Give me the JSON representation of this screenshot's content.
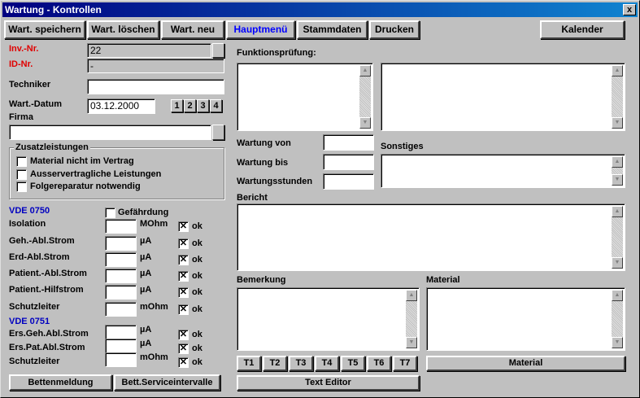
{
  "window": {
    "title": "Wartung - Kontrollen",
    "close_glyph": "x"
  },
  "toolbar": {
    "save": "Wart. speichern",
    "delete": "Wart. löschen",
    "new": "Wart. neu",
    "main_menu": "Hauptmenü",
    "master_data": "Stammdaten",
    "print": "Drucken",
    "calendar": "Kalender"
  },
  "form": {
    "inv_label": "Inv.-Nr.",
    "inv_value": "22",
    "id_label": "ID-Nr.",
    "id_value": "-",
    "tech_label": "Techniker",
    "tech_value": "",
    "date_label": "Wart.-Datum",
    "date_value": "03.12.2000",
    "date_buttons": [
      "1",
      "2",
      "3",
      "4"
    ],
    "firm_label": "Firma",
    "firm_value": ""
  },
  "extras": {
    "title": "Zusatzleistungen",
    "items": [
      "Material nicht im Vertrag",
      "Ausservertragliche Leistungen",
      "Folgereparatur notwendig"
    ],
    "checked": [
      false,
      false,
      false
    ]
  },
  "vde0750": {
    "title": "VDE 0750",
    "hazard_label": "Gefährdung",
    "hazard_checked": false,
    "rows": [
      {
        "label": "Isolation",
        "value": "",
        "unit": "MOhm",
        "ok": "ok",
        "ok_checked": true
      },
      {
        "label": "Geh.-Abl.Strom",
        "value": "",
        "unit": "µA",
        "ok": "ok",
        "ok_checked": true
      },
      {
        "label": "Erd-Abl.Strom",
        "value": "",
        "unit": "µA",
        "ok": "ok",
        "ok_checked": true
      },
      {
        "label": "Patient.-Abl.Strom",
        "value": "",
        "unit": "µA",
        "ok": "ok",
        "ok_checked": true
      },
      {
        "label": "Patient.-Hilfstrom",
        "value": "",
        "unit": "µA",
        "ok": "ok",
        "ok_checked": true
      },
      {
        "label": "Schutzleiter",
        "value": "",
        "unit": "mOhm",
        "ok": "ok",
        "ok_checked": true
      }
    ]
  },
  "vde0751": {
    "title": "VDE 0751",
    "rows": [
      {
        "label": "Ers.Geh.Abl.Strom",
        "value": "",
        "unit": "µA",
        "ok": "ok",
        "ok_checked": true
      },
      {
        "label": "Ers.Pat.Abl.Strom",
        "value": "",
        "unit": "µA",
        "ok": "ok",
        "ok_checked": true
      },
      {
        "label": "Schutzleiter",
        "value": "",
        "unit": "mOhm",
        "ok": "ok",
        "ok_checked": true
      }
    ]
  },
  "bottom_left": {
    "bed_report": "Bettenmeldung",
    "service_interval": "Bett.Serviceintervalle"
  },
  "right": {
    "function_test_label": "Funktionsprüfung:",
    "maint_from_label": "Wartung von",
    "maint_to_label": "Wartung bis",
    "maint_hours_label": "Wartungsstunden",
    "misc_label": "Sonstiges",
    "report_label": "Bericht",
    "remark_label": "Bemerkung",
    "material_label": "Material",
    "t_buttons": [
      "T1",
      "T2",
      "T3",
      "T4",
      "T5",
      "T6",
      "T7"
    ],
    "material_button": "Material",
    "text_editor_button": "Text Editor"
  },
  "check_glyph": "✕",
  "scroll": {
    "up": "▲",
    "down": "▼"
  }
}
